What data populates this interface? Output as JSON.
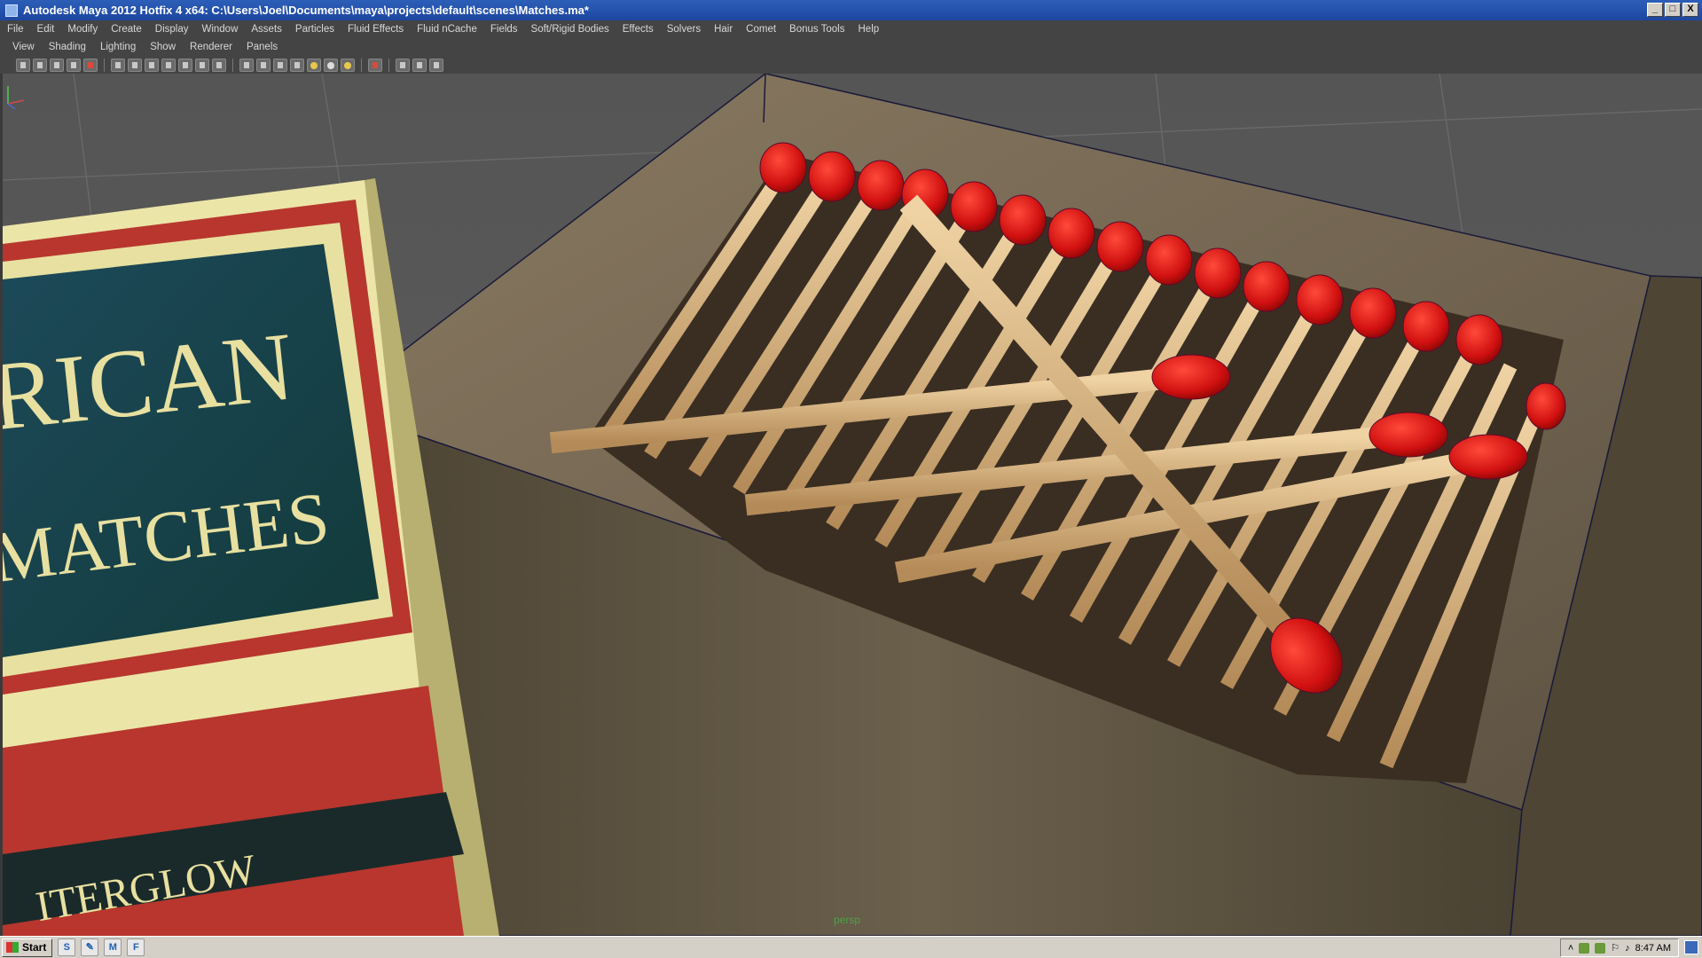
{
  "window": {
    "title": "Autodesk Maya 2012 Hotfix 4 x64: C:\\Users\\Joel\\Documents\\maya\\projects\\default\\scenes\\Matches.ma*",
    "minimize": "_",
    "maximize": "□",
    "close": "X"
  },
  "menubar": [
    "File",
    "Edit",
    "Modify",
    "Create",
    "Display",
    "Window",
    "Assets",
    "Particles",
    "Fluid Effects",
    "Fluid nCache",
    "Fields",
    "Soft/Rigid Bodies",
    "Effects",
    "Solvers",
    "Hair",
    "Comet",
    "Bonus Tools",
    "Help"
  ],
  "panel_menu": [
    "View",
    "Shading",
    "Lighting",
    "Show",
    "Renderer",
    "Panels"
  ],
  "toolbar_icons": [
    "select-camera-icon",
    "camera-attributes-icon",
    "bookmark-icon",
    "image-plane-icon",
    "2d-pan-icon",
    "grid-icon",
    "film-gate-icon",
    "resolution-gate-icon",
    "gate-mask-icon",
    "field-chart-icon",
    "safe-action-icon",
    "safe-title-icon",
    "wireframe-icon",
    "smooth-shade-icon",
    "wireframe-on-shaded-icon",
    "xray-icon",
    "default-light-icon",
    "all-lights-icon",
    "shadows-icon",
    "isolate-select-icon",
    "xray-joints-icon",
    "backface-icon",
    "show-manipulators-icon"
  ],
  "viewport": {
    "camera": "persp",
    "box_label_lines": [
      "RICAN",
      "MATCHES",
      "ITERGLOW"
    ]
  },
  "taskbar": {
    "start": "Start",
    "quick_launch": [
      "S",
      "✎",
      "M",
      "F"
    ],
    "clock": "8:47 AM"
  },
  "colors": {
    "title_bar": "#1d46a0",
    "ui_panel": "#444444",
    "viewport_bg": "#575757",
    "match_head": "#d81414",
    "match_stick": "#d8b688",
    "box_tray": "#6e6250"
  }
}
